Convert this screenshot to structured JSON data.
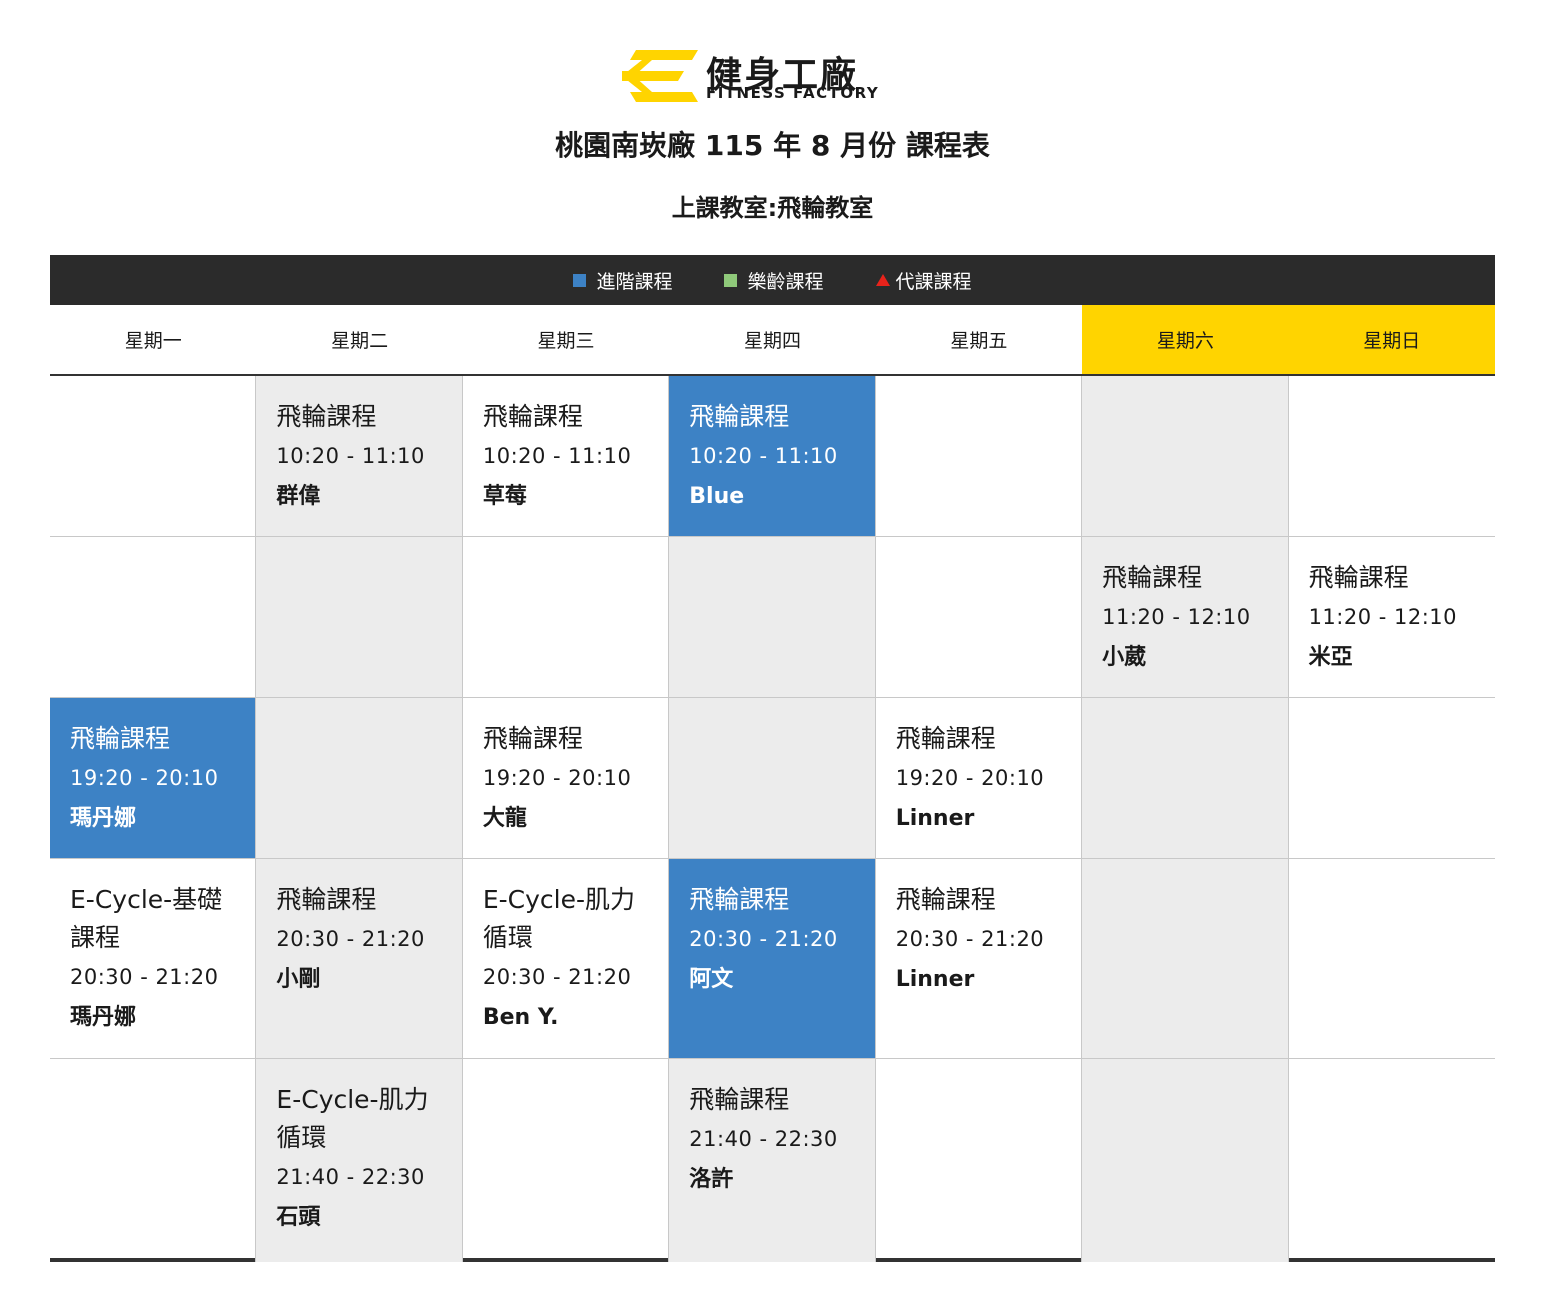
{
  "brand": {
    "name_cn": "健身工廠",
    "name_en": "FITNESS FACTORY",
    "colors": {
      "logo_yellow": "#ffd400",
      "text": "#1a1a1a"
    }
  },
  "header": {
    "title": "桃園南崁廠 115 年 8 月份 課程表",
    "subtitle": "上課教室:飛輪教室"
  },
  "legend": [
    {
      "label": "進階課程",
      "color": "#3d82c5",
      "shape": "square"
    },
    {
      "label": "樂齡課程",
      "color": "#8fc97a",
      "shape": "square"
    },
    {
      "label": "代課課程",
      "color": "#e8231b",
      "shape": "triangle"
    }
  ],
  "days": [
    "星期一",
    "星期二",
    "星期三",
    "星期四",
    "星期五",
    "星期六",
    "星期日"
  ],
  "colors": {
    "advanced": "#3d82c5",
    "weekend_header": "#ffd400",
    "gray_column": "#ececec",
    "legend_bar": "#2b2b2b"
  },
  "schedule": [
    [
      null,
      {
        "course": "飛輪課程",
        "time": "10:20 - 11:10",
        "teacher": "群偉",
        "type": "normal"
      },
      {
        "course": "飛輪課程",
        "time": "10:20 - 11:10",
        "teacher": "草莓",
        "type": "normal"
      },
      {
        "course": "飛輪課程",
        "time": "10:20 - 11:10",
        "teacher": "Blue",
        "type": "advanced"
      },
      null,
      null,
      null
    ],
    [
      null,
      null,
      null,
      null,
      null,
      {
        "course": "飛輪課程",
        "time": "11:20 - 12:10",
        "teacher": "小葳",
        "type": "normal"
      },
      {
        "course": "飛輪課程",
        "time": "11:20 - 12:10",
        "teacher": "米亞",
        "type": "normal"
      }
    ],
    [
      {
        "course": "飛輪課程",
        "time": "19:20 - 20:10",
        "teacher": "瑪丹娜",
        "type": "advanced"
      },
      null,
      {
        "course": "飛輪課程",
        "time": "19:20 - 20:10",
        "teacher": "大龍",
        "type": "normal"
      },
      null,
      {
        "course": "飛輪課程",
        "time": "19:20 - 20:10",
        "teacher": "Linner",
        "type": "normal"
      },
      null,
      null
    ],
    [
      {
        "course": "E-Cycle-基礎課程",
        "time": "20:30 - 21:20",
        "teacher": "瑪丹娜",
        "type": "normal"
      },
      {
        "course": "飛輪課程",
        "time": "20:30 - 21:20",
        "teacher": "小剛",
        "type": "normal"
      },
      {
        "course": "E-Cycle-肌力循環",
        "time": "20:30 - 21:20",
        "teacher": "Ben Y.",
        "type": "normal"
      },
      {
        "course": "飛輪課程",
        "time": "20:30 - 21:20",
        "teacher": "阿文",
        "type": "advanced"
      },
      {
        "course": "飛輪課程",
        "time": "20:30 - 21:20",
        "teacher": "Linner",
        "type": "normal"
      },
      null,
      null
    ],
    [
      null,
      {
        "course": "E-Cycle-肌力循環",
        "time": "21:40 - 22:30",
        "teacher": "石頭",
        "type": "normal"
      },
      null,
      {
        "course": "飛輪課程",
        "time": "21:40 - 22:30",
        "teacher": "洛許",
        "type": "normal"
      },
      null,
      null,
      null
    ]
  ]
}
